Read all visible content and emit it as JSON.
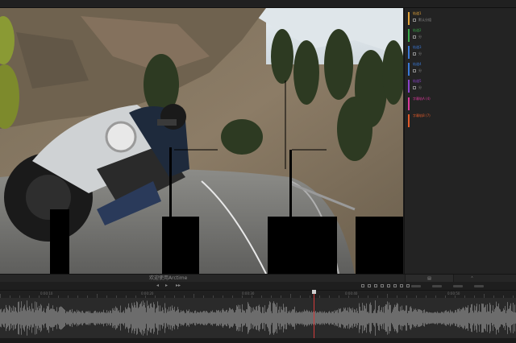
{
  "status": {
    "welcome": "欢迎使用Arctime"
  },
  "tracks": [
    {
      "name": "轨道1",
      "sub": "默认分组",
      "color": "#e0a23a"
    },
    {
      "name": "轨道2",
      "sub": "分",
      "color": "#3aa84a"
    },
    {
      "name": "轨道3",
      "sub": "分",
      "color": "#3a78d6"
    },
    {
      "name": "轨道4",
      "sub": "分",
      "color": "#3a7ad8"
    },
    {
      "name": "轨道5",
      "sub": "分",
      "color": "#8a44cc"
    },
    {
      "name": "字幕轨A (4)",
      "sub": "",
      "color": "#d93a9a"
    },
    {
      "name": "字幕轨B (7)",
      "sub": "",
      "color": "#e05a2a"
    }
  ],
  "toolbar": {
    "rewind_icon": "rewind-icon",
    "play_icon": "play-icon",
    "forward_icon": "forward-icon"
  },
  "ruler": {
    "labels": [
      "0:00:10",
      "0:00:20",
      "0:00:30",
      "0:00:40",
      "0:00:50"
    ]
  },
  "colors": {
    "playhead": "#d23b3b",
    "panel_bg": "#232323"
  }
}
